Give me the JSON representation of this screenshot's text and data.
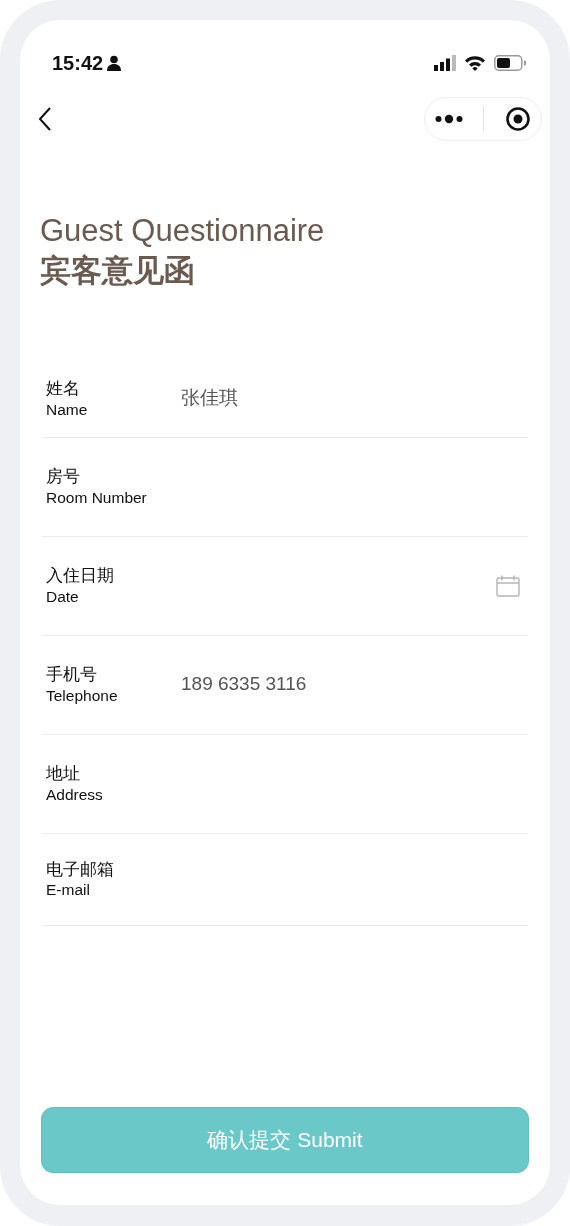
{
  "status_bar": {
    "time": "15:42"
  },
  "title": {
    "english": "Guest Questionnaire",
    "chinese": "宾客意见函"
  },
  "fields": [
    {
      "kind": "text",
      "label_cn": "姓名",
      "label_en": "Name",
      "value": "张佳琪"
    },
    {
      "kind": "text",
      "label_cn": "房号",
      "label_en": "Room Number"
    },
    {
      "kind": "date",
      "label_cn": "入住日期",
      "label_en": "Date"
    },
    {
      "kind": "text",
      "label_cn": "手机号",
      "label_en": "Telephone",
      "value": "189 6335 3116"
    },
    {
      "kind": "text",
      "label_cn": "地址",
      "label_en": "Address"
    },
    {
      "kind": "text",
      "label_cn": "电子邮箱",
      "label_en": "E-mail"
    }
  ],
  "submit_button": {
    "label": "确认提交 Submit"
  }
}
